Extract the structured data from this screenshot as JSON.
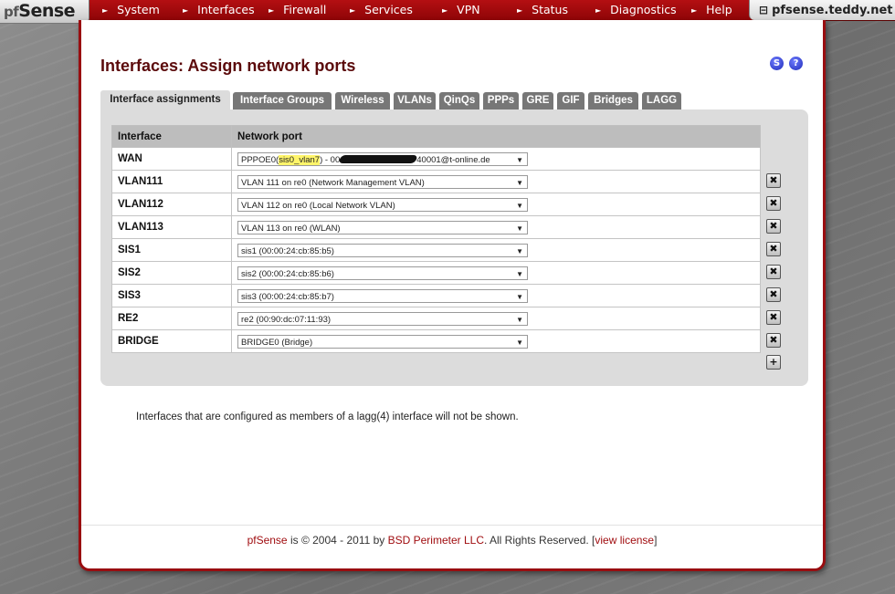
{
  "logo": {
    "prefix": "pf",
    "text": "Sense"
  },
  "menu": [
    "System",
    "Interfaces",
    "Firewall",
    "Services",
    "VPN",
    "Status",
    "Diagnostics",
    "Help"
  ],
  "hostname": "pfsense.teddy.net",
  "page": {
    "title": "Interfaces: Assign network ports",
    "status_icon": "S",
    "help_icon": "?"
  },
  "tabs": [
    {
      "label": "Interface assignments",
      "active": true
    },
    {
      "label": "Interface Groups",
      "active": false
    },
    {
      "label": "Wireless",
      "active": false
    },
    {
      "label": "VLANs",
      "active": false
    },
    {
      "label": "QinQs",
      "active": false
    },
    {
      "label": "PPPs",
      "active": false
    },
    {
      "label": "GRE",
      "active": false
    },
    {
      "label": "GIF",
      "active": false
    },
    {
      "label": "Bridges",
      "active": false
    },
    {
      "label": "LAGG",
      "active": false
    }
  ],
  "table": {
    "headers": [
      "Interface",
      "Network port"
    ],
    "rows": [
      {
        "name": "WAN",
        "port_before": "PPPOE0(",
        "port_highlight": "sis0_vlan7",
        "port_middle": ") - 00",
        "port_after": "40001@t-online.de",
        "deletable": false
      },
      {
        "name": "VLAN111",
        "port": "VLAN 111 on re0 (Network Management VLAN)",
        "deletable": true
      },
      {
        "name": "VLAN112",
        "port": "VLAN 112 on re0 (Local Network VLAN)",
        "deletable": true
      },
      {
        "name": "VLAN113",
        "port": "VLAN 113 on re0 (WLAN)",
        "deletable": true
      },
      {
        "name": "SIS1",
        "port": "sis1 (00:00:24:cb:85:b5)",
        "deletable": true
      },
      {
        "name": "SIS2",
        "port": "sis2 (00:00:24:cb:85:b6)",
        "deletable": true
      },
      {
        "name": "SIS3",
        "port": "sis3 (00:00:24:cb:85:b7)",
        "deletable": true
      },
      {
        "name": "RE2",
        "port": "re2 (00:90:dc:07:11:93)",
        "deletable": true
      },
      {
        "name": "BRIDGE",
        "port": "BRIDGE0 (Bridge)",
        "deletable": true
      }
    ]
  },
  "note": "Interfaces that are configured as members of a lagg(4) interface will not be shown.",
  "footer": {
    "product": "pfSense",
    "is_text": " is © 2004 - 2011 by ",
    "company": "BSD Perimeter LLC",
    "rights": ". All Rights Reserved. [",
    "license_link": "view license",
    "close": "]"
  },
  "icons": {
    "delete": "delete-interface-icon",
    "add": "add-interface-icon",
    "dropdown": "chevron-down-icon"
  },
  "colors": {
    "brand_red": "#990d10",
    "title_red": "#5b0a0b",
    "tab_grey": "#777777",
    "box_grey": "#dcdcdc"
  }
}
